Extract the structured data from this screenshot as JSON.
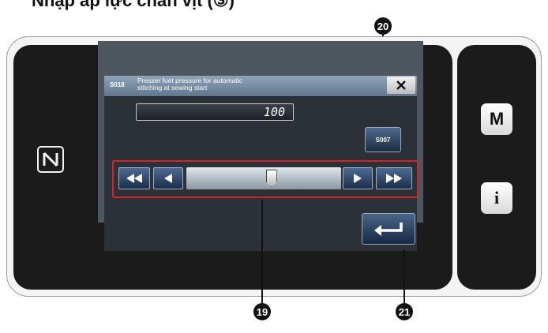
{
  "heading": "Nhập áp lực chân vịt (③)",
  "dialog": {
    "code": "S018",
    "title_line1": "Presser foot pressure for automatic",
    "title_line2": "stitching at sewing start",
    "value": "100",
    "code_button_label": "S007",
    "slider_fraction": 0.55
  },
  "side_buttons": {
    "mode_label": "M",
    "info_label": "i"
  },
  "callouts": {
    "c19": "19",
    "c20": "20",
    "c21": "21"
  },
  "icons": {
    "close": "close-icon",
    "fast_rewind": "double-left-arrow-icon",
    "step_back": "left-arrow-icon",
    "step_forward": "right-arrow-icon",
    "fast_forward": "double-right-arrow-icon",
    "enter": "enter-icon",
    "nfc": "nfc-icon"
  },
  "colors": {
    "highlight": "#d2232a",
    "button_blue": "#2b456b",
    "titlebar": "#7b8ea4"
  }
}
